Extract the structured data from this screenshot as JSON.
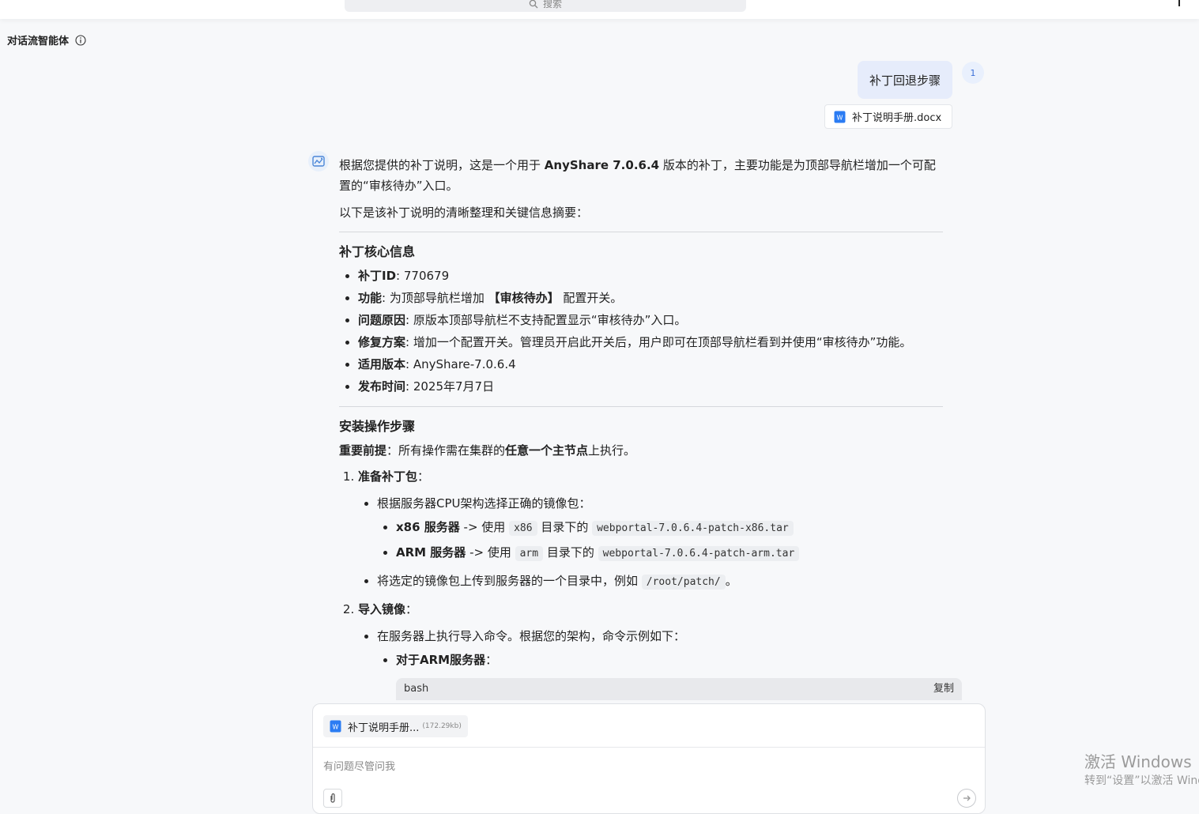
{
  "search": {
    "label": "搜索"
  },
  "agent": {
    "title": "对话流智能体"
  },
  "user_message": {
    "text": "补丁回退步骤",
    "avatar_label": "1",
    "attachment": "补丁说明手册.docx"
  },
  "answer": {
    "intro_a": "根据您提供的补丁说明，这是一个用于 ",
    "intro_product": "AnyShare 7.0.6.4",
    "intro_b": " 版本的补丁，主要功能是为顶部导航栏增加一个可配置的“审核待办”入口。",
    "lead": "以下是该补丁说明的清晰整理和关键信息摘要：",
    "core_title": "补丁核心信息",
    "core_items": [
      {
        "label": "补丁ID",
        "value": ": 770679"
      },
      {
        "label": "功能",
        "value": ": 为顶部导航栏增加 ",
        "strong": "【审核待办】",
        "tail": " 配置开关。"
      },
      {
        "label": "问题原因",
        "value": ": 原版本顶部导航栏不支持配置显示“审核待办”入口。"
      },
      {
        "label": "修复方案",
        "value": ": 增加一个配置开关。管理员开启此开关后，用户即可在顶部导航栏看到并使用“审核待办”功能。"
      },
      {
        "label": "适用版本",
        "value": ": AnyShare-7.0.6.4"
      },
      {
        "label": "发布时间",
        "value": ": 2025年7月7日"
      }
    ],
    "install_title": "安装操作步骤",
    "prereq_label": "重要前提",
    "prereq_a": "：所有操作需在集群的",
    "prereq_strong": "任意一个主节点",
    "prereq_b": "上执行。",
    "step1_title": "准备补丁包",
    "step1_colon": "：",
    "step1_bullet1": "根据服务器CPU架构选择正确的镜像包：",
    "x86_label": "x86 服务器",
    "x86_use": " -> 使用 ",
    "x86_dir": "x86",
    "x86_mid": " 目录下的 ",
    "x86_file": "webportal-7.0.6.4-patch-x86.tar",
    "arm_label": "ARM 服务器",
    "arm_use": " -> 使用 ",
    "arm_dir": "arm",
    "arm_mid": " 目录下的 ",
    "arm_file": "webportal-7.0.6.4-patch-arm.tar",
    "upload_a": "将选定的镜像包上传到服务器的一个目录中，例如 ",
    "upload_path": "/root/patch/",
    "upload_b": "。",
    "step2_title": "导入镜像",
    "step2_colon": "：",
    "step2_bullet": "在服务器上执行导入命令。根据您的架构，命令示例如下：",
    "arm_server_label": "对于ARM服务器",
    "arm_server_colon": "：",
    "code_lang": "bash",
    "code_copy": "复制"
  },
  "composer": {
    "file_name": "补丁说明手册...",
    "file_size": "(172.29kb)",
    "placeholder": "有问题尽管问我"
  },
  "watermark": {
    "line1": "激活 Windows",
    "line2": "转到“设置”以激活 Windows。"
  },
  "colors": {
    "accent": "#3a6fd8",
    "user_bubble": "#e6ecfb",
    "word_blue": "#2b7cf3"
  }
}
